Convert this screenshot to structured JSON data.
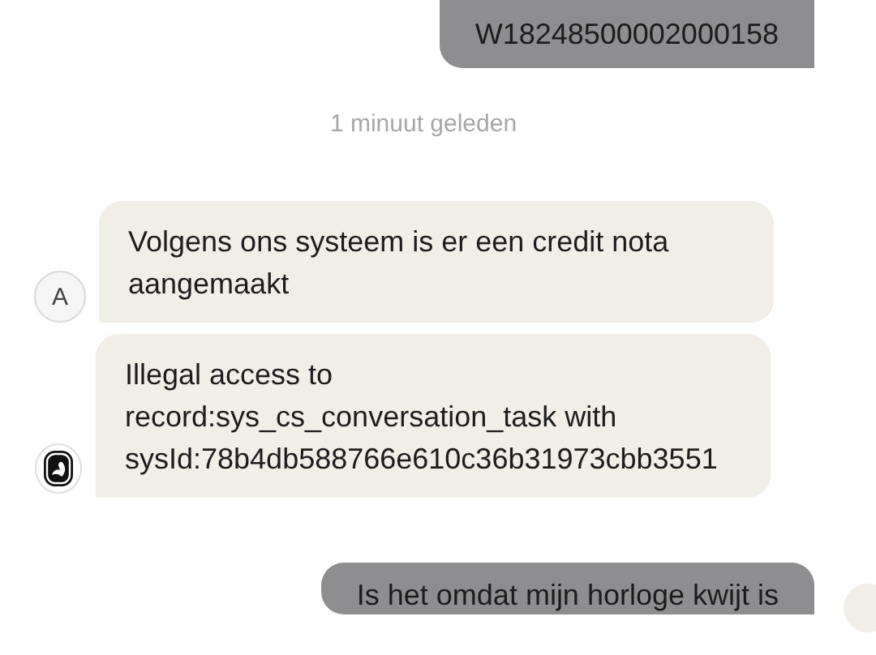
{
  "messages": [
    {
      "kind": "user",
      "text": "W18248500002000158"
    },
    {
      "kind": "timestamp",
      "text": "1 minuut geleden"
    },
    {
      "kind": "agent",
      "avatar_letter": "A",
      "text": "Volgens ons systeem is er een credit nota aangemaakt"
    },
    {
      "kind": "bot",
      "text": "Illegal access to record:sys_cs_conversation_task with sysId:78b4db588766e610c36b31973cbb3551"
    },
    {
      "kind": "user",
      "text": "Is het omdat mijn horloge kwijt is"
    }
  ]
}
